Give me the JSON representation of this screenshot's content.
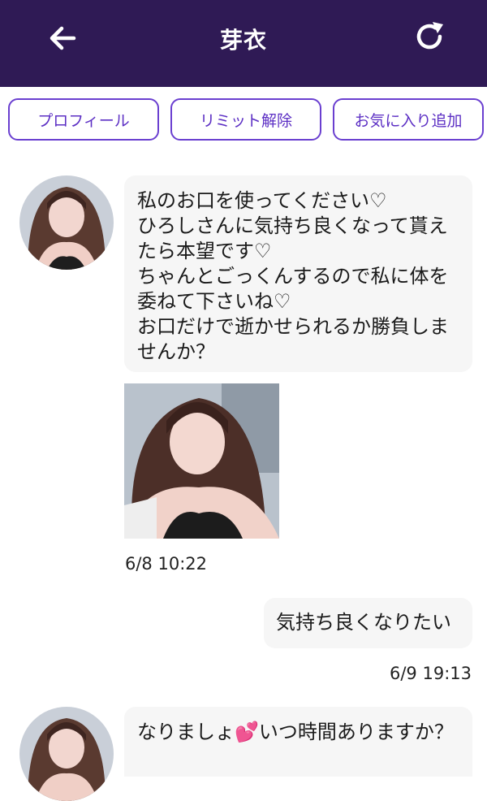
{
  "header": {
    "title": "芽衣",
    "back_icon": "arrow-left-icon",
    "refresh_icon": "refresh-icon",
    "background": "#2f1a55"
  },
  "actions": {
    "profile_label": "プロフィール",
    "limit_release_label": "リミット解除",
    "add_favorite_label": "お気に入り追加",
    "accent": "#6a3fd0"
  },
  "messages": [
    {
      "text": "私のお口を使ってください♡\nひろしさんに気持ち良くなって貰えたら本望です♡\nちゃんとごっくんするので私に体を委ねて下さいね♡\nお口だけで逝かせられるか勝負しませんか？",
      "timestamp": "6/8 10:22"
    },
    {
      "text": "気持ち良くなりたい",
      "timestamp": "6/9 19:13"
    },
    {
      "text": "なりましょ💕いつ時間ありますか？"
    }
  ]
}
